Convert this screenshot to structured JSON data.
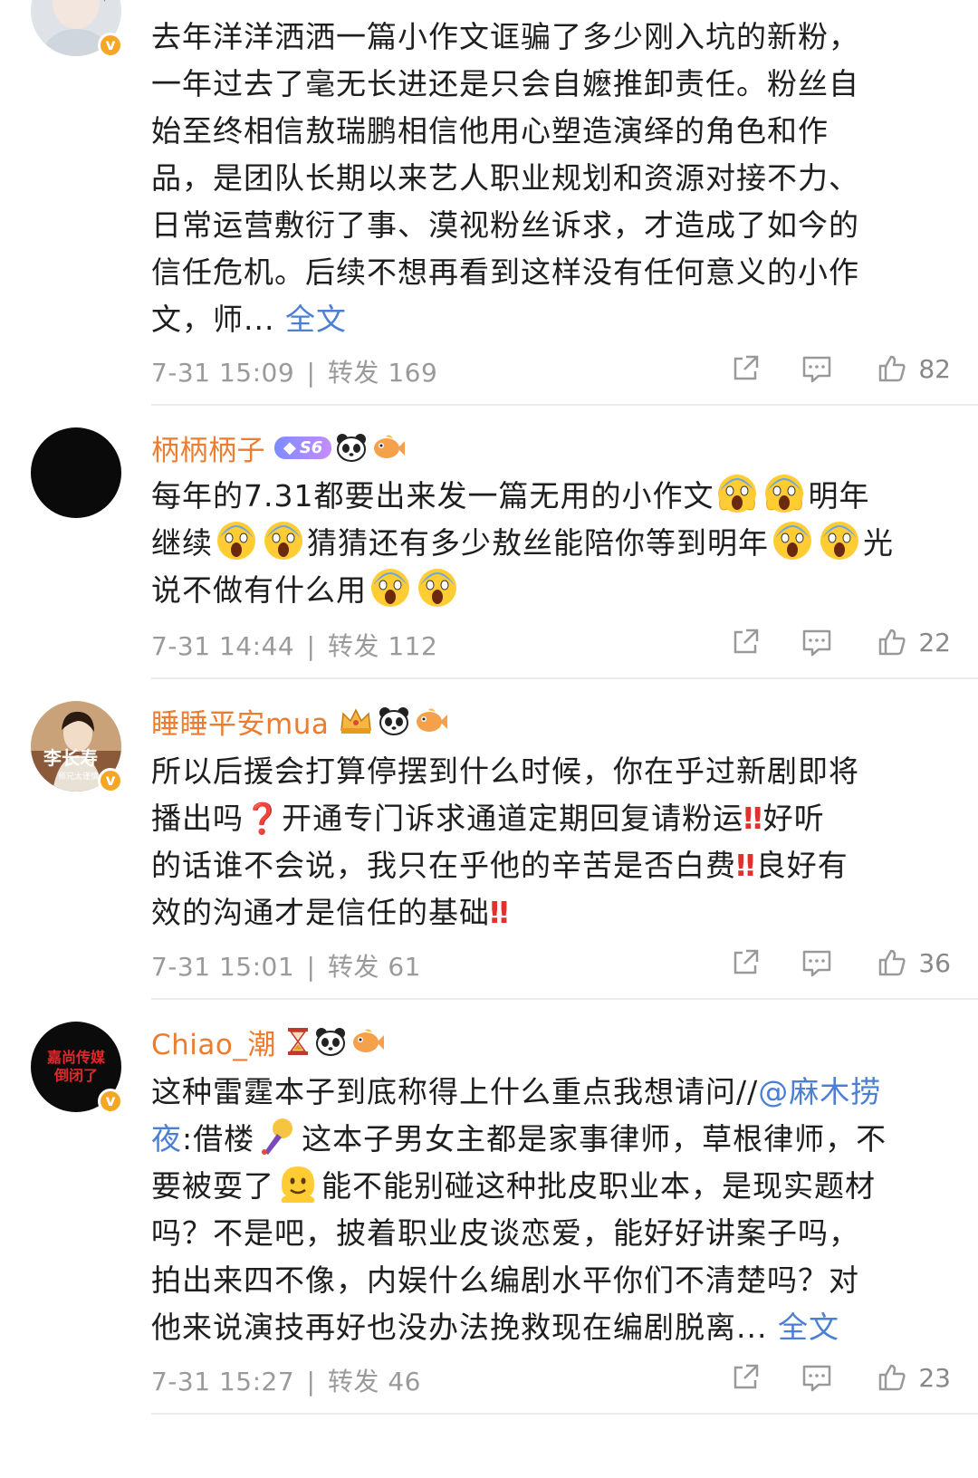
{
  "posts": [
    {
      "user": "",
      "text_lines": [
        "去年洋洋洒洒一篇小作文诓骗了多少刚入坑的新粉，",
        "一年过去了毫无长进还是只会自嬷推卸责任。粉丝自",
        "始至终相信敖瑞鹏相信他用心塑造演绎的角色和作",
        "品，是团队长期以来艺人职业规划和资源对接不力、",
        "日常运营敷衍了事、漠视粉丝诉求，才造成了如今的",
        "信任危机。后续不想再看到这样没有任何意义的小作",
        "文，师..."
      ],
      "more_link": "全文",
      "time": "7-31 15:09",
      "sep": "|",
      "repost_label": "转发",
      "repost_count": "169",
      "like_count": "82"
    },
    {
      "user": "柄柄柄子",
      "level_badge": "S6",
      "text_lines": [
        [
          "每年的7.31都要出来发一篇无用的小作文",
          "@e",
          "@e",
          "明年"
        ],
        [
          "继续",
          "@e",
          "@e",
          "猜猜还有多少敖丝能陪你等到明年",
          "@e",
          "@e",
          "光"
        ],
        [
          "说不做有什么用",
          "@e",
          "@e"
        ]
      ],
      "time": "7-31 14:44",
      "sep": "|",
      "repost_label": "转发",
      "repost_count": "112",
      "like_count": "22"
    },
    {
      "user": "睡睡平安mua",
      "avatar_text": "李长寿",
      "avatar_subtext": "师兄太谨慎",
      "line1": "所以后援会打算停摆到什么时候，你在乎过新剧即将",
      "line2a": "播出吗",
      "line2b": "开通专门诉求通道定期回复请粉运",
      "line2c": "好听",
      "line3a": "的话谁不会说，我只在乎他的辛苦是否白费",
      "line3b": "良好有",
      "line4a": "效的沟通才是信任的基础",
      "question_mark": "❓",
      "double_exclaim": "‼",
      "time": "7-31 15:01",
      "sep": "|",
      "repost_label": "转发",
      "repost_count": "61",
      "like_count": "36"
    },
    {
      "user": "Chiao_潮",
      "avatar_line1": "嘉尚传媒",
      "avatar_line2": "倒闭了",
      "line1a": "这种雷霆本子到底称得上什么重点我想请问//",
      "mention1": "@麻木捞",
      "mention2": "夜",
      "line2a": ":借楼",
      "line2b": "这本子男女主都是家事律师，草根律师，不",
      "line3a": "要被耍了",
      "line3b": "能不能别碰这种批皮职业本，是现实题材",
      "line4": "吗？不是吧，披着职业皮谈恋爱，能好好讲案子吗，",
      "line5": "拍出来四不像，内娱什么编剧水平你们不清楚吗？对",
      "line6": "他来说演技再好也没办法挽救现在编剧脱离...",
      "more_link": "全文",
      "time": "7-31 15:27",
      "sep": "|",
      "repost_label": "转发",
      "repost_count": "46",
      "like_count": "23"
    }
  ],
  "verified_mark": "v",
  "colors": {
    "username": "#ec7c2f",
    "link": "#4a7fd4",
    "meta": "#9a9a9a",
    "verified": "#f5a623"
  }
}
